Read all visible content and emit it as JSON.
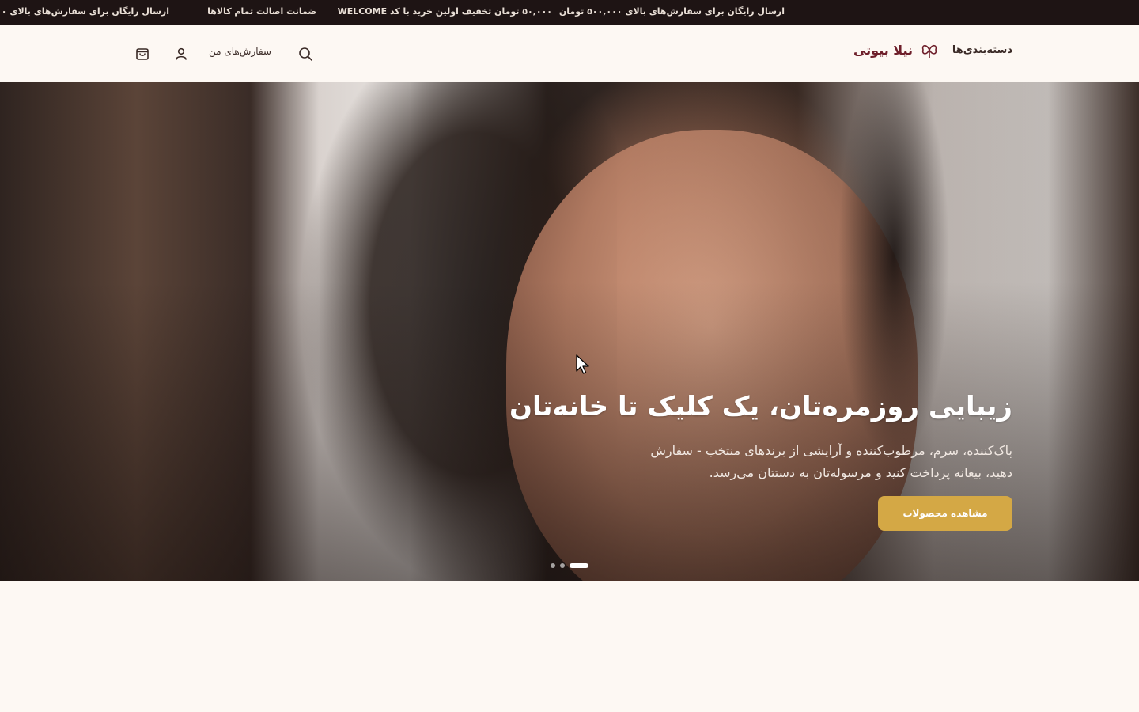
{
  "announcement": {
    "messages": [
      "ارسال رایگان برای سفارش‌های بالای ۵۰۰,۰۰۰ تومان",
      "۵۰,۰۰۰ تومان تخفیف اولین خرید با کد WELCOME",
      "ضمانت اصالت تمام کالاها",
      "ارسال رایگان برای سفارش‌های بالای ۵۰۰,۰۰۰ تومان",
      "ارسال رایگان برای سفارش‌های بالای ۵۰۰,۰۰۰ تو"
    ]
  },
  "header": {
    "categories_label": "دسته‌بندی‌ها",
    "brand_name": "نیلا بیوتی",
    "orders_label": "سفارش‌های من",
    "icons": [
      "flower-logo-icon",
      "search-icon",
      "user-icon",
      "shopping-bag-icon"
    ]
  },
  "hero": {
    "title": "زیبایی روزمره‌تان، یک کلیک تا خانه‌تان",
    "subtitle": "پاک‌کننده، سرم، مرطوب‌کننده و آرایشی از برندهای منتخب - سفارش دهید، بیعانه پرداخت کنید و مرسوله‌تان به دستتان می‌رسد.",
    "cta_label": "مشاهده محصولات",
    "slides_count": 3,
    "active_slide": 1
  },
  "colors": {
    "announcement_bg": "#1e1414",
    "page_bg": "#fdf8f3",
    "brand": "#6e1f2a",
    "cta": "#d4a845"
  }
}
